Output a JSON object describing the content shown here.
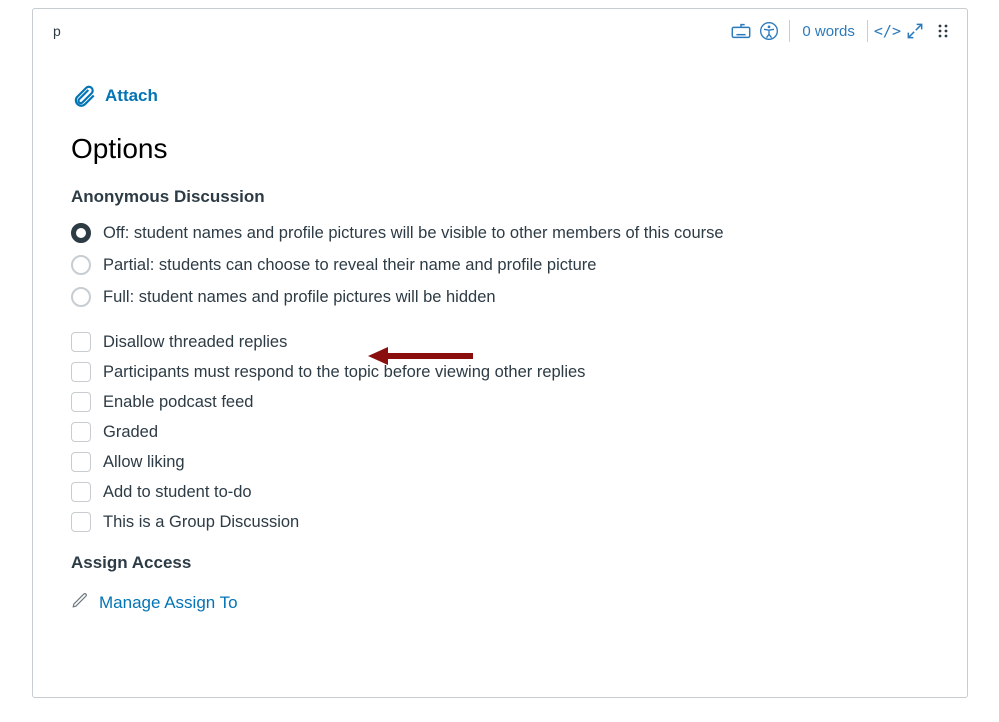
{
  "editor": {
    "element_tag": "p",
    "word_count_label": "0 words",
    "code_label": "</>"
  },
  "attach": {
    "label": "Attach"
  },
  "options": {
    "heading": "Options"
  },
  "anon": {
    "heading": "Anonymous Discussion",
    "radios": [
      {
        "key": "off",
        "selected": true,
        "label": "Off: student names and profile pictures will be visible to other members of this course"
      },
      {
        "key": "partial",
        "selected": false,
        "label": "Partial: students can choose to reveal their name and profile picture"
      },
      {
        "key": "full",
        "selected": false,
        "label": "Full: student names and profile pictures will be hidden"
      }
    ]
  },
  "checks": [
    {
      "key": "disallow_threaded",
      "label": "Disallow threaded replies"
    },
    {
      "key": "respond_first",
      "label": "Participants must respond to the topic before viewing other replies"
    },
    {
      "key": "podcast",
      "label": "Enable podcast feed"
    },
    {
      "key": "graded",
      "label": "Graded"
    },
    {
      "key": "liking",
      "label": "Allow liking"
    },
    {
      "key": "todo",
      "label": "Add to student to-do"
    },
    {
      "key": "group",
      "label": "This is a Group Discussion"
    }
  ],
  "assign": {
    "heading": "Assign Access",
    "manage_label": "Manage Assign To"
  }
}
